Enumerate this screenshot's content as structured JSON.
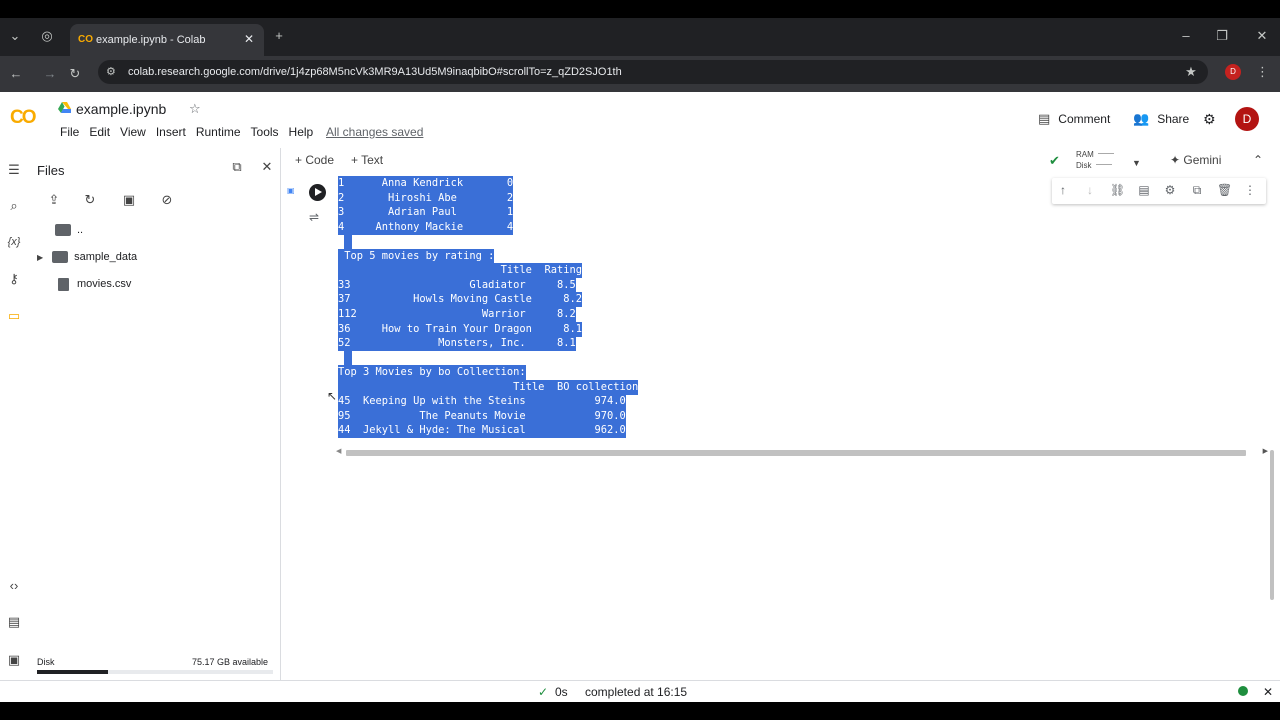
{
  "browser": {
    "tab_title": "example.ipynb - Colab",
    "url": "colab.research.google.com/drive/1j4zp68M5ncVk3MR9A13Ud5M9inaqbibO#scrollTo=z_qZD2SJO1th",
    "profile_initial": "D"
  },
  "colab": {
    "notebook_title": "example.ipynb",
    "menu": [
      "File",
      "Edit",
      "View",
      "Insert",
      "Runtime",
      "Tools",
      "Help"
    ],
    "save_status": "All changes saved",
    "comment_label": "Comment",
    "share_label": "Share",
    "avatar_initial": "D",
    "add_code_label": "+ Code",
    "add_text_label": "+ Text",
    "ram_label": "RAM",
    "disk_label": "Disk",
    "gemini_label": "Gemini"
  },
  "files_panel": {
    "title": "Files",
    "tree": [
      {
        "name": "..",
        "kind": "folder"
      },
      {
        "name": "sample_data",
        "kind": "folder"
      },
      {
        "name": "movies.csv",
        "kind": "file"
      }
    ],
    "disk_label": "Disk",
    "disk_available": "75.17 GB available",
    "disk_used_fraction": 0.3
  },
  "output_lines": [
    "1      Anna Kendrick       0",
    "2       Hiroshi Abe        2",
    "3       Adrian Paul        1",
    "4     Anthony Mackie       4",
    "",
    " Top 5 movies by rating :",
    "                          Title  Rating",
    "33                   Gladiator     8.5",
    "37          Howls Moving Castle     8.2",
    "112                    Warrior     8.2",
    "36     How to Train Your Dragon     8.1",
    "52              Monsters, Inc.     8.1",
    "",
    "Top 3 Movies by bo Collection:",
    "                            Title  BO collection",
    "45  Keeping Up with the Steins           974.0",
    "95           The Peanuts Movie           970.0",
    "44  Jekyll & Hyde: The Musical           962.0"
  ],
  "status": {
    "elapsed": "0s",
    "completed": "completed at 16:15"
  },
  "colors": {
    "selection": "#3a6fd7",
    "accent": "#f9ab00",
    "ok": "#1e8e3e"
  }
}
